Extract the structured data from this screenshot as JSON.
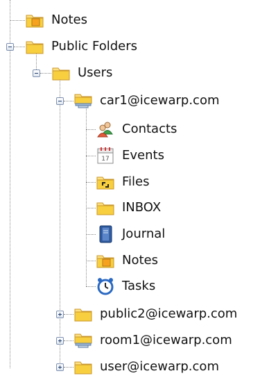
{
  "tree": {
    "root_items": {
      "notes": {
        "label": "Notes",
        "icon": "notes-folder-icon"
      },
      "public_folders": {
        "label": "Public Folders",
        "icon": "folder-icon",
        "expanded": true,
        "users": {
          "label": "Users",
          "icon": "folder-icon",
          "expanded": true,
          "accounts": [
            {
              "label": "car1@icewarp.com",
              "icon": "shared-folder-icon",
              "expanded": true,
              "children": [
                {
                  "label": "Contacts",
                  "icon": "contacts-icon"
                },
                {
                  "label": "Events",
                  "icon": "calendar-icon"
                },
                {
                  "label": "Files",
                  "icon": "files-folder-icon"
                },
                {
                  "label": "INBOX",
                  "icon": "folder-icon"
                },
                {
                  "label": "Journal",
                  "icon": "journal-icon"
                },
                {
                  "label": "Notes",
                  "icon": "notes-folder-icon"
                },
                {
                  "label": "Tasks",
                  "icon": "alarm-clock-icon"
                }
              ]
            },
            {
              "label": "public2@icewarp.com",
              "icon": "folder-icon",
              "expanded": false
            },
            {
              "label": "room1@icewarp.com",
              "icon": "shared-folder-icon",
              "expanded": false
            },
            {
              "label": "user@icewarp.com",
              "icon": "folder-icon",
              "expanded": false
            }
          ]
        }
      }
    }
  },
  "colors": {
    "folder_yellow": "#f7cf3f",
    "folder_edge": "#c9962a",
    "line": "#8a8a8a",
    "expander_border": "#7d8fb0"
  }
}
